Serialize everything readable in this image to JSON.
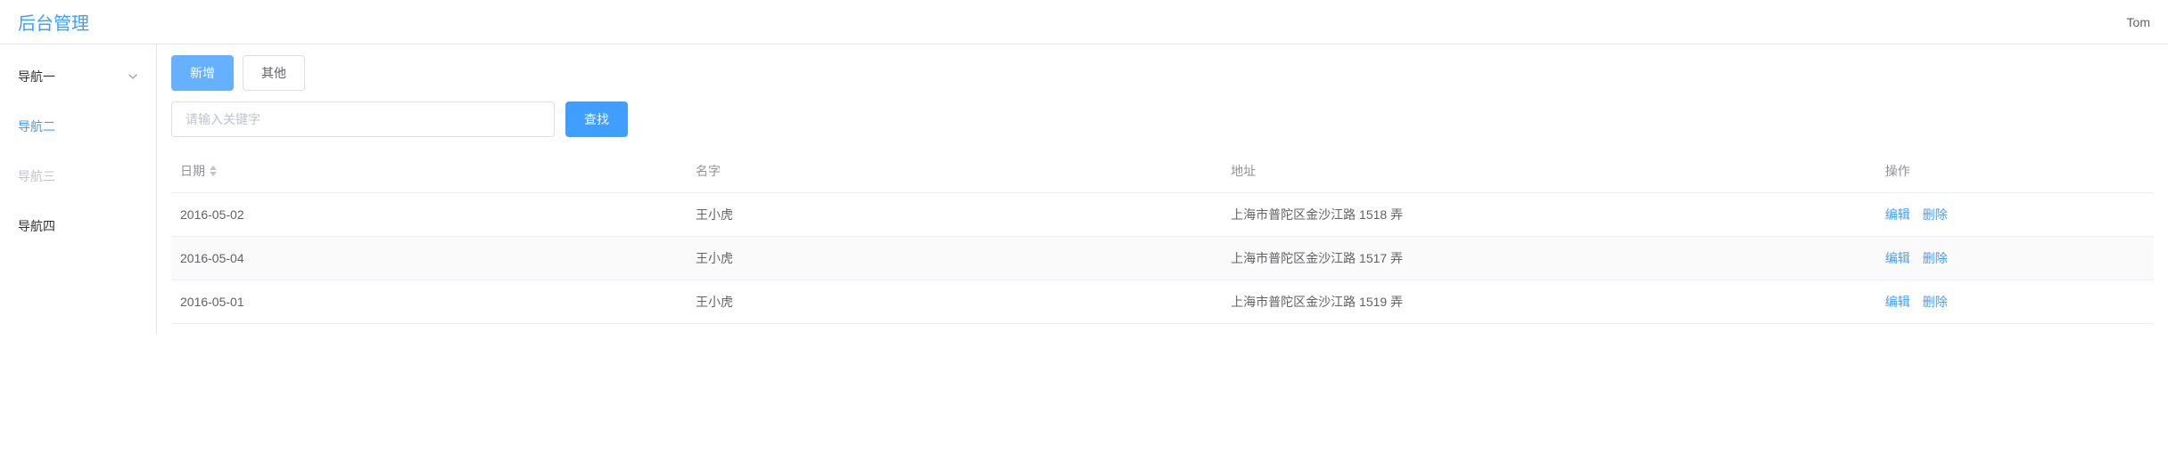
{
  "header": {
    "title": "后台管理",
    "user": "Tom"
  },
  "sidebar": {
    "items": [
      {
        "label": "导航一",
        "has_children": true,
        "state": "normal"
      },
      {
        "label": "导航二",
        "has_children": false,
        "state": "active"
      },
      {
        "label": "导航三",
        "has_children": false,
        "state": "disabled"
      },
      {
        "label": "导航四",
        "has_children": false,
        "state": "normal"
      }
    ]
  },
  "toolbar": {
    "add_label": "新增",
    "other_label": "其他"
  },
  "search": {
    "placeholder": "请输入关键字",
    "button_label": "查找"
  },
  "table": {
    "columns": {
      "date": "日期",
      "name": "名字",
      "address": "地址",
      "operation": "操作"
    },
    "actions": {
      "edit": "编辑",
      "delete": "删除"
    },
    "rows": [
      {
        "date": "2016-05-02",
        "name": "王小虎",
        "address": "上海市普陀区金沙江路 1518 弄"
      },
      {
        "date": "2016-05-04",
        "name": "王小虎",
        "address": "上海市普陀区金沙江路 1517 弄"
      },
      {
        "date": "2016-05-01",
        "name": "王小虎",
        "address": "上海市普陀区金沙江路 1519 弄"
      }
    ]
  }
}
